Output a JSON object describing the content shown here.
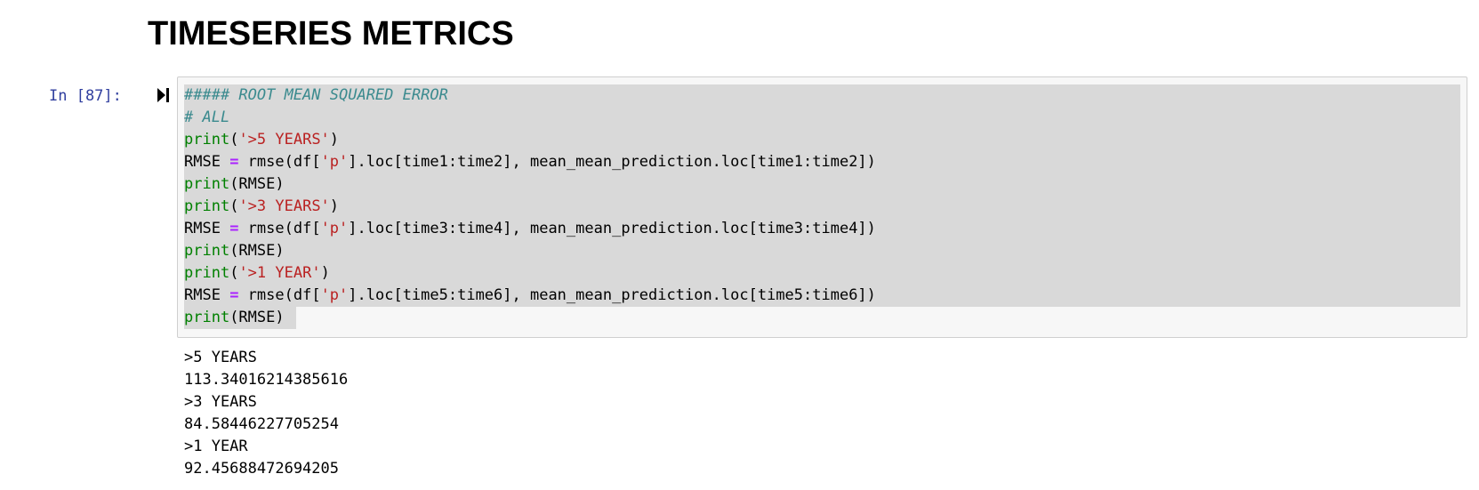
{
  "heading": "TIMESERIES METRICS",
  "cell": {
    "prompt": "In [87]:",
    "run_icon": "run-cell-icon",
    "code_lines": [
      [
        {
          "t": "##### ROOT MEAN SQUARED ERROR",
          "c": "comment"
        }
      ],
      [
        {
          "t": "# ALL",
          "c": "comment"
        }
      ],
      [
        {
          "t": "print",
          "c": "builtin"
        },
        {
          "t": "(",
          "c": ""
        },
        {
          "t": "'>5 YEARS'",
          "c": "string"
        },
        {
          "t": ")",
          "c": ""
        }
      ],
      [
        {
          "t": "RMSE ",
          "c": ""
        },
        {
          "t": "=",
          "c": "op"
        },
        {
          "t": " rmse(df[",
          "c": ""
        },
        {
          "t": "'p'",
          "c": "string"
        },
        {
          "t": "].loc[time1:time2], mean_mean_prediction.loc[time1:time2])",
          "c": ""
        }
      ],
      [
        {
          "t": "print",
          "c": "builtin"
        },
        {
          "t": "(RMSE)",
          "c": ""
        }
      ],
      [
        {
          "t": "print",
          "c": "builtin"
        },
        {
          "t": "(",
          "c": ""
        },
        {
          "t": "'>3 YEARS'",
          "c": "string"
        },
        {
          "t": ")",
          "c": ""
        }
      ],
      [
        {
          "t": "RMSE ",
          "c": ""
        },
        {
          "t": "=",
          "c": "op"
        },
        {
          "t": " rmse(df[",
          "c": ""
        },
        {
          "t": "'p'",
          "c": "string"
        },
        {
          "t": "].loc[time3:time4], mean_mean_prediction.loc[time3:time4])",
          "c": ""
        }
      ],
      [
        {
          "t": "print",
          "c": "builtin"
        },
        {
          "t": "(RMSE)",
          "c": ""
        }
      ],
      [
        {
          "t": "print",
          "c": "builtin"
        },
        {
          "t": "(",
          "c": ""
        },
        {
          "t": "'>1 YEAR'",
          "c": "string"
        },
        {
          "t": ")",
          "c": ""
        }
      ],
      [
        {
          "t": "RMSE ",
          "c": ""
        },
        {
          "t": "=",
          "c": "op"
        },
        {
          "t": " rmse(df[",
          "c": ""
        },
        {
          "t": "'p'",
          "c": "string"
        },
        {
          "t": "].loc[time5:time6], mean_mean_prediction.loc[time5:time6])",
          "c": ""
        }
      ],
      [
        {
          "t": "print",
          "c": "builtin"
        },
        {
          "t": "(RMSE)",
          "c": ""
        }
      ]
    ]
  },
  "output_lines": [
    ">5 YEARS",
    "113.34016214385616",
    ">3 YEARS",
    "84.58446227705254",
    ">1 YEAR",
    "92.45688472694205"
  ],
  "colors": {
    "prompt": "#303f9f",
    "comment": "#3a8a8e",
    "builtin": "#008000",
    "string": "#ba2121",
    "operator": "#aa22ff",
    "selection": "#d9d9d9"
  }
}
